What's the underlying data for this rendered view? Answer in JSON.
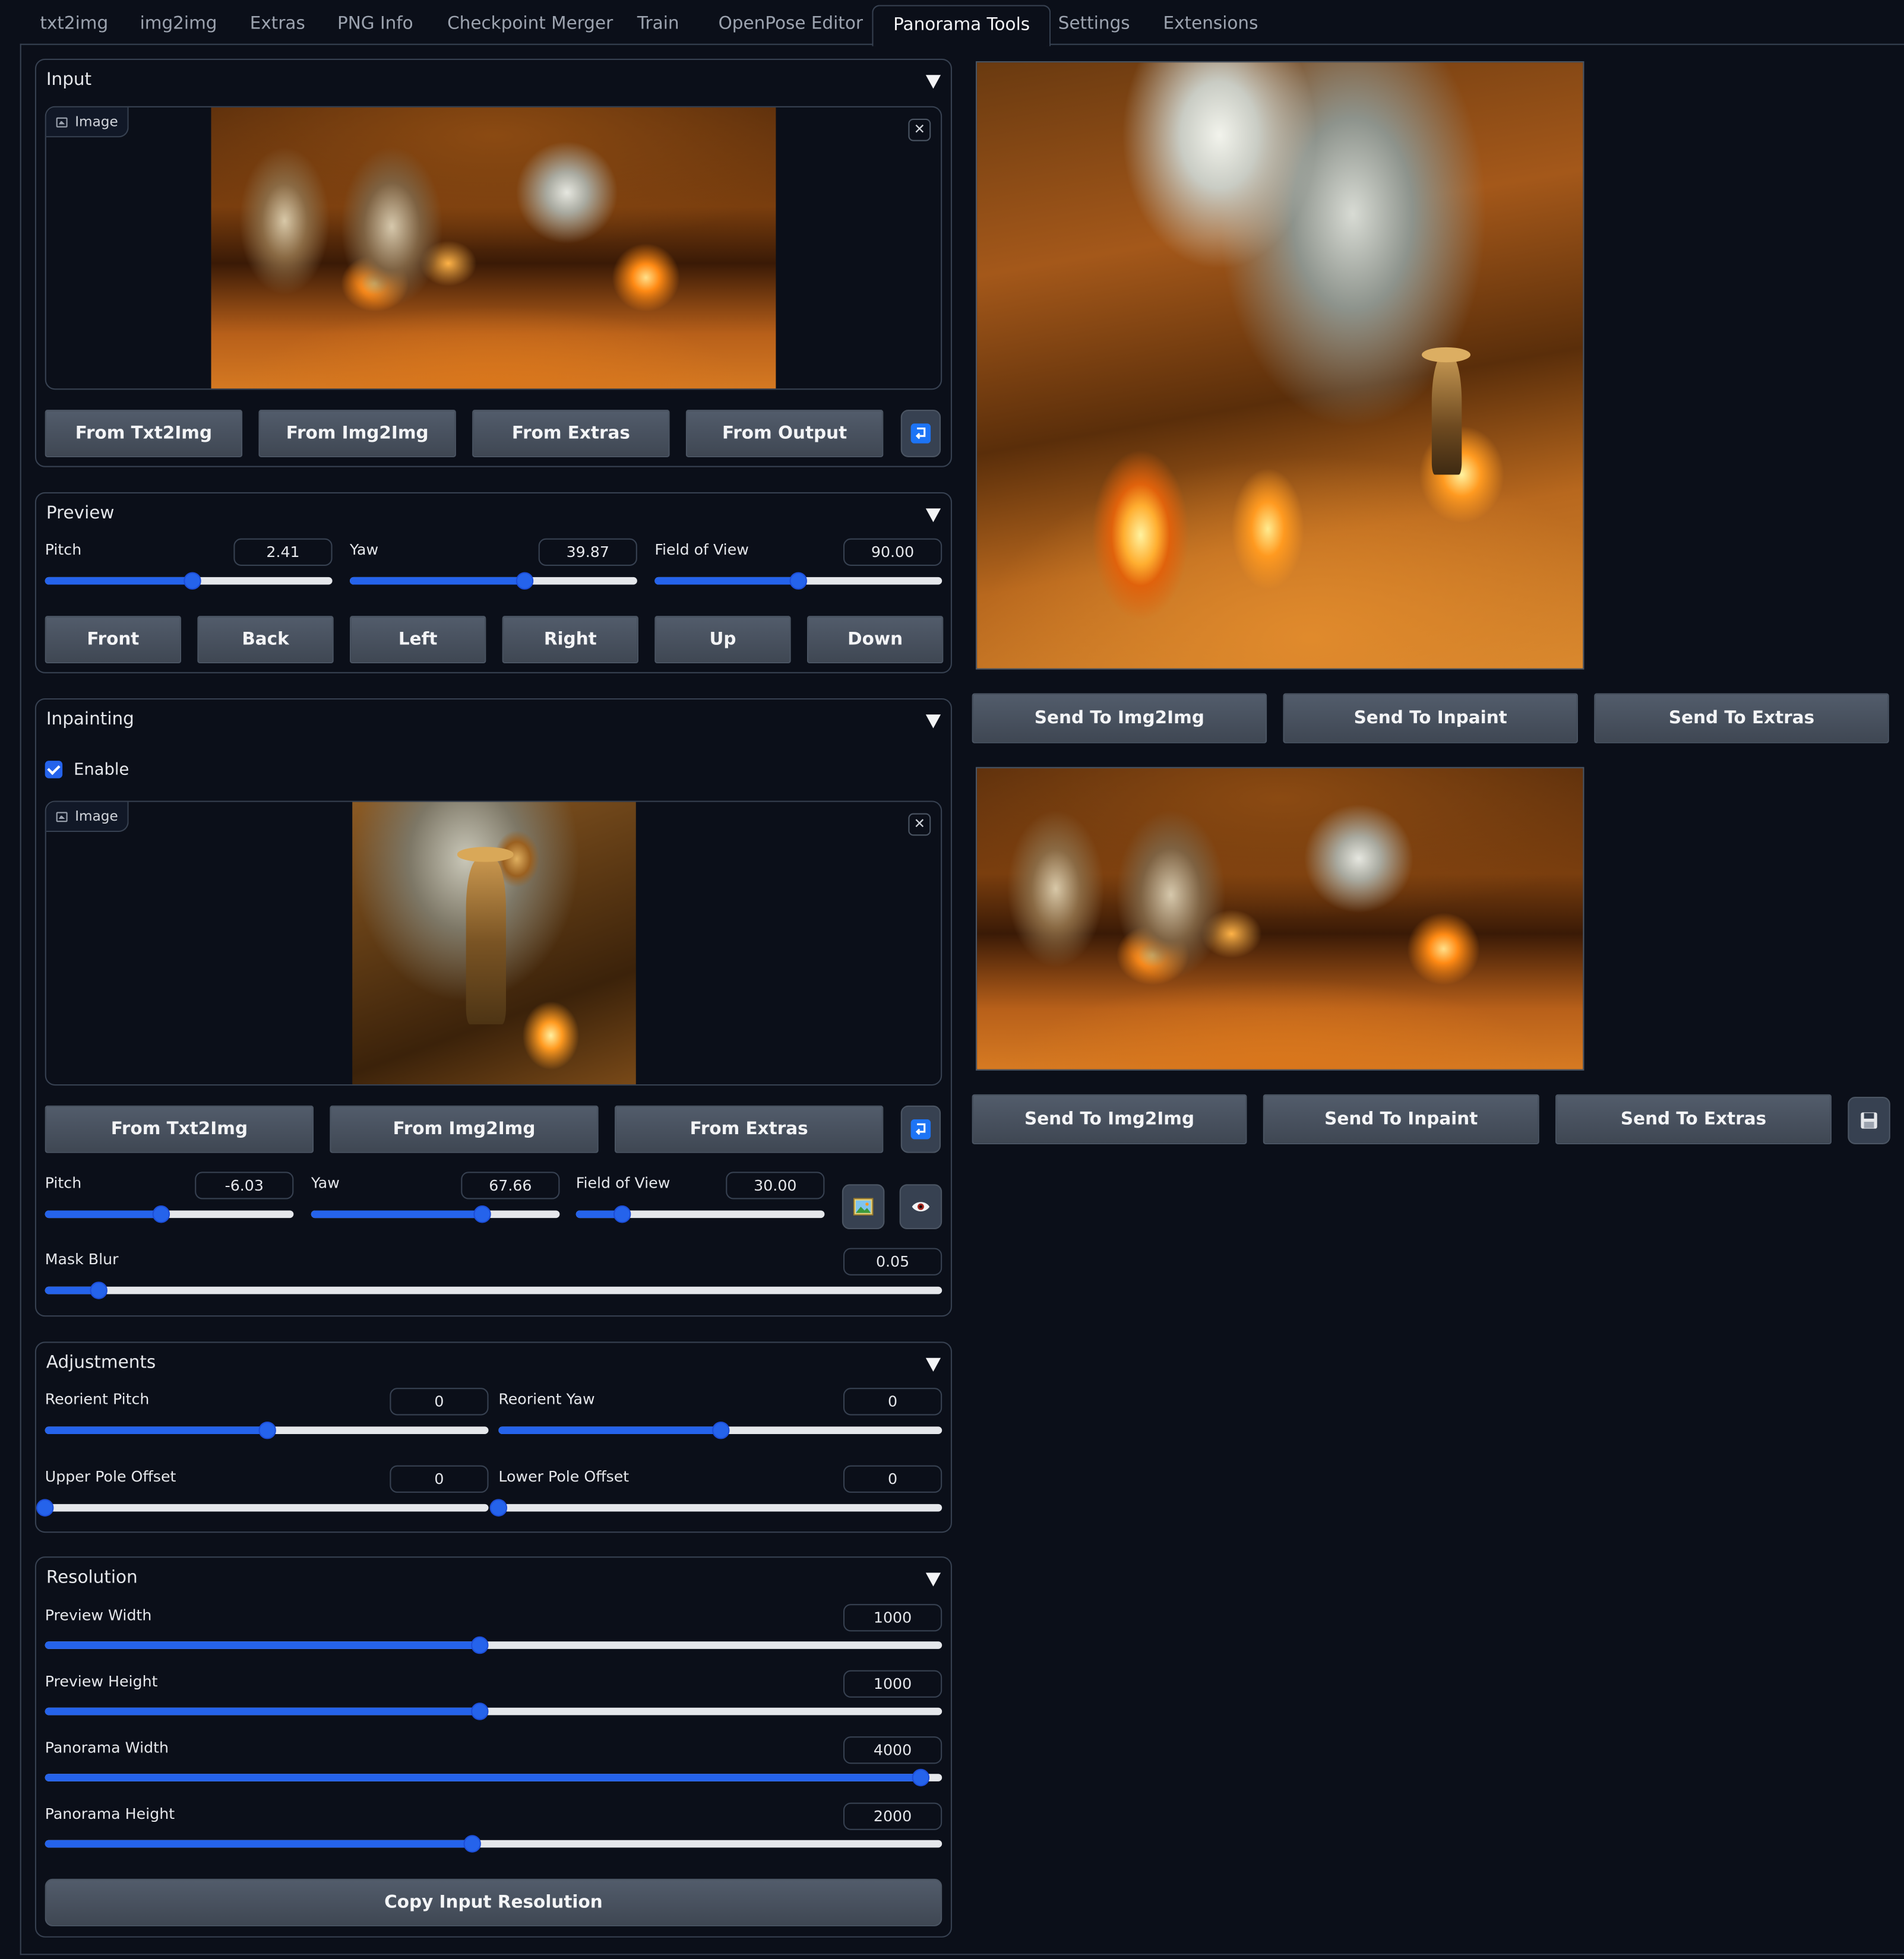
{
  "tabs": [
    "txt2img",
    "img2img",
    "Extras",
    "PNG Info",
    "Checkpoint Merger",
    "Train",
    "OpenPose Editor",
    "Panorama Tools",
    "Settings",
    "Extensions"
  ],
  "selected_tab": "Panorama Tools",
  "input": {
    "title": "Input",
    "image_label": "Image",
    "close_glyph": "✕",
    "buttons": [
      "From Txt2Img",
      "From Img2Img",
      "From Extras",
      "From Output"
    ],
    "icon": "reuse-icon"
  },
  "preview": {
    "title": "Preview",
    "sliders": [
      {
        "label": "Pitch",
        "value": "2.41",
        "level": 0.5134
      },
      {
        "label": "Yaw",
        "value": "39.87",
        "level": 0.6107
      },
      {
        "label": "Field of View",
        "value": "90.00",
        "level": 0.5
      }
    ],
    "buttons": [
      "Front",
      "Back",
      "Left",
      "Right",
      "Up",
      "Down"
    ]
  },
  "inpainting": {
    "title": "Inpainting",
    "enable_label": "Enable",
    "enabled": true,
    "image_label": "Image",
    "close_glyph": "✕",
    "buttons": [
      "From Txt2Img",
      "From Img2Img",
      "From Extras"
    ],
    "sliders": [
      {
        "label": "Pitch",
        "value": "-6.03",
        "level": 0.4665
      },
      {
        "label": "Yaw",
        "value": "67.66",
        "level": 0.688
      },
      {
        "label": "Field of View",
        "value": "30.00",
        "level": 0.1875
      }
    ],
    "mask_blur": {
      "label": "Mask Blur",
      "value": "0.05",
      "level": 0.06
    },
    "icons": [
      "image-icon",
      "eye-icon"
    ]
  },
  "adjustments": {
    "title": "Adjustments",
    "sliders": [
      {
        "label": "Reorient Pitch",
        "value": "0",
        "level": 0.5
      },
      {
        "label": "Reorient Yaw",
        "value": "0",
        "level": 0.5
      },
      {
        "label": "Upper Pole Offset",
        "value": "0",
        "level": 0.0
      },
      {
        "label": "Lower Pole Offset",
        "value": "0",
        "level": 0.0
      }
    ]
  },
  "resolution": {
    "title": "Resolution",
    "sliders": [
      {
        "label": "Preview Width",
        "value": "1000",
        "level": 0.485
      },
      {
        "label": "Preview Height",
        "value": "1000",
        "level": 0.485
      },
      {
        "label": "Panorama Width",
        "value": "4000",
        "level": 0.976
      },
      {
        "label": "Panorama Height",
        "value": "2000",
        "level": 0.477
      }
    ],
    "copy_button": "Copy Input Resolution"
  },
  "output": {
    "send_buttons_top": [
      "Send To Img2Img",
      "Send To Inpaint",
      "Send To Extras"
    ],
    "send_buttons_bottom": [
      "Send To Img2Img",
      "Send To Inpaint",
      "Send To Extras"
    ],
    "save_icon": "save-icon"
  },
  "colors": {
    "accent": "#2563eb",
    "background": "#0b0f19",
    "border": "#374151",
    "button": "#4b5563"
  }
}
